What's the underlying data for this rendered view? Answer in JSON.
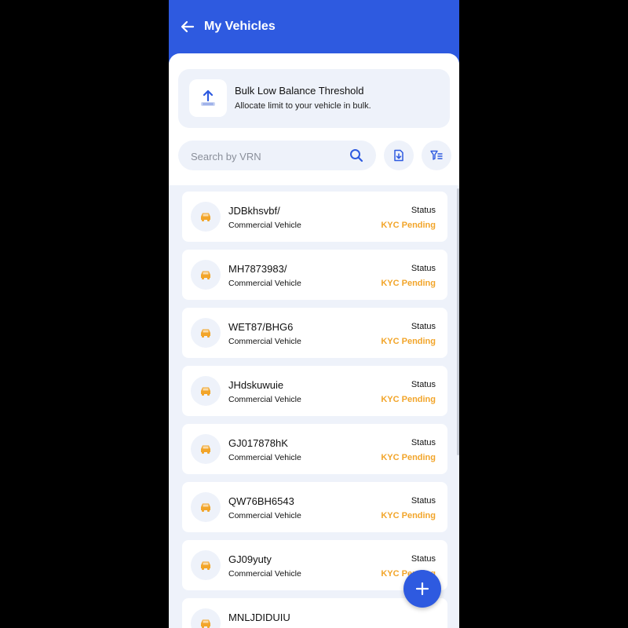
{
  "header": {
    "title": "My Vehicles"
  },
  "bulk": {
    "title": "Bulk Low Balance Threshold",
    "subtitle": "Allocate limit to your vehicle in bulk."
  },
  "search": {
    "placeholder": "Search by VRN",
    "value": ""
  },
  "colors": {
    "primary": "#2e5ae0",
    "pending": "#f2a52a",
    "surface": "#eef2fa"
  },
  "vehicles": [
    {
      "vrn": "JDBkhsvbf/",
      "type": "Commercial Vehicle",
      "status_label": "Status",
      "status": "KYC Pending"
    },
    {
      "vrn": "MH7873983/",
      "type": "Commercial Vehicle",
      "status_label": "Status",
      "status": "KYC Pending"
    },
    {
      "vrn": "WET87/BHG6",
      "type": "Commercial Vehicle",
      "status_label": "Status",
      "status": "KYC Pending"
    },
    {
      "vrn": "JHdskuwuie",
      "type": "Commercial Vehicle",
      "status_label": "Status",
      "status": "KYC Pending"
    },
    {
      "vrn": "GJ017878hK",
      "type": "Commercial Vehicle",
      "status_label": "Status",
      "status": "KYC Pending"
    },
    {
      "vrn": "QW76BH6543",
      "type": "Commercial Vehicle",
      "status_label": "Status",
      "status": "KYC Pending"
    },
    {
      "vrn": "GJ09yuty",
      "type": "Commercial Vehicle",
      "status_label": "Status",
      "status": "KYC Pending"
    },
    {
      "vrn": "MNLJDIDUIU",
      "type": "",
      "status_label": "",
      "status": ""
    }
  ],
  "icons": {
    "back": "back-arrow-icon",
    "upload": "upload-icon",
    "search": "search-icon",
    "download": "download-file-icon",
    "filter": "filter-icon",
    "car": "car-icon",
    "add": "plus-icon"
  }
}
